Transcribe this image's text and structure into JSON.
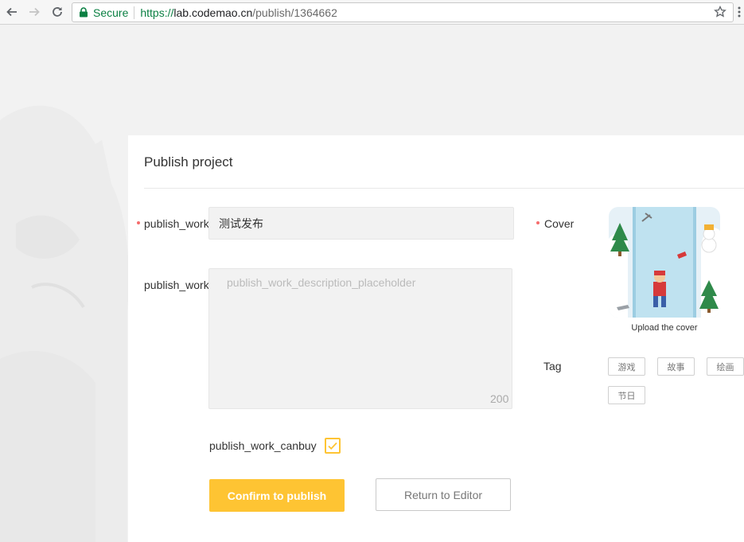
{
  "browser": {
    "secure_label": "Secure",
    "url_scheme": "https://",
    "url_host": "lab.codemao.cn",
    "url_path": "/publish/1364662"
  },
  "page": {
    "title": "Publish project",
    "name_label": "publish_work_name",
    "name_value": "测试发布",
    "description_label": "publish_work_description",
    "description_placeholder": "publish_work_description_placeholder",
    "description_value": "",
    "description_count": "200",
    "canbuy_label": "publish_work_canbuy",
    "canbuy_checked": true,
    "confirm_label": "Confirm to publish",
    "return_label": "Return to Editor",
    "cover_label": "Cover",
    "cover_caption": "Upload the cover",
    "tag_label": "Tag",
    "tags": [
      "游戏",
      "故事",
      "绘画",
      "节日"
    ]
  },
  "colors": {
    "accent": "#fec433",
    "required": "#f56c6c",
    "secure": "#0b8043"
  }
}
